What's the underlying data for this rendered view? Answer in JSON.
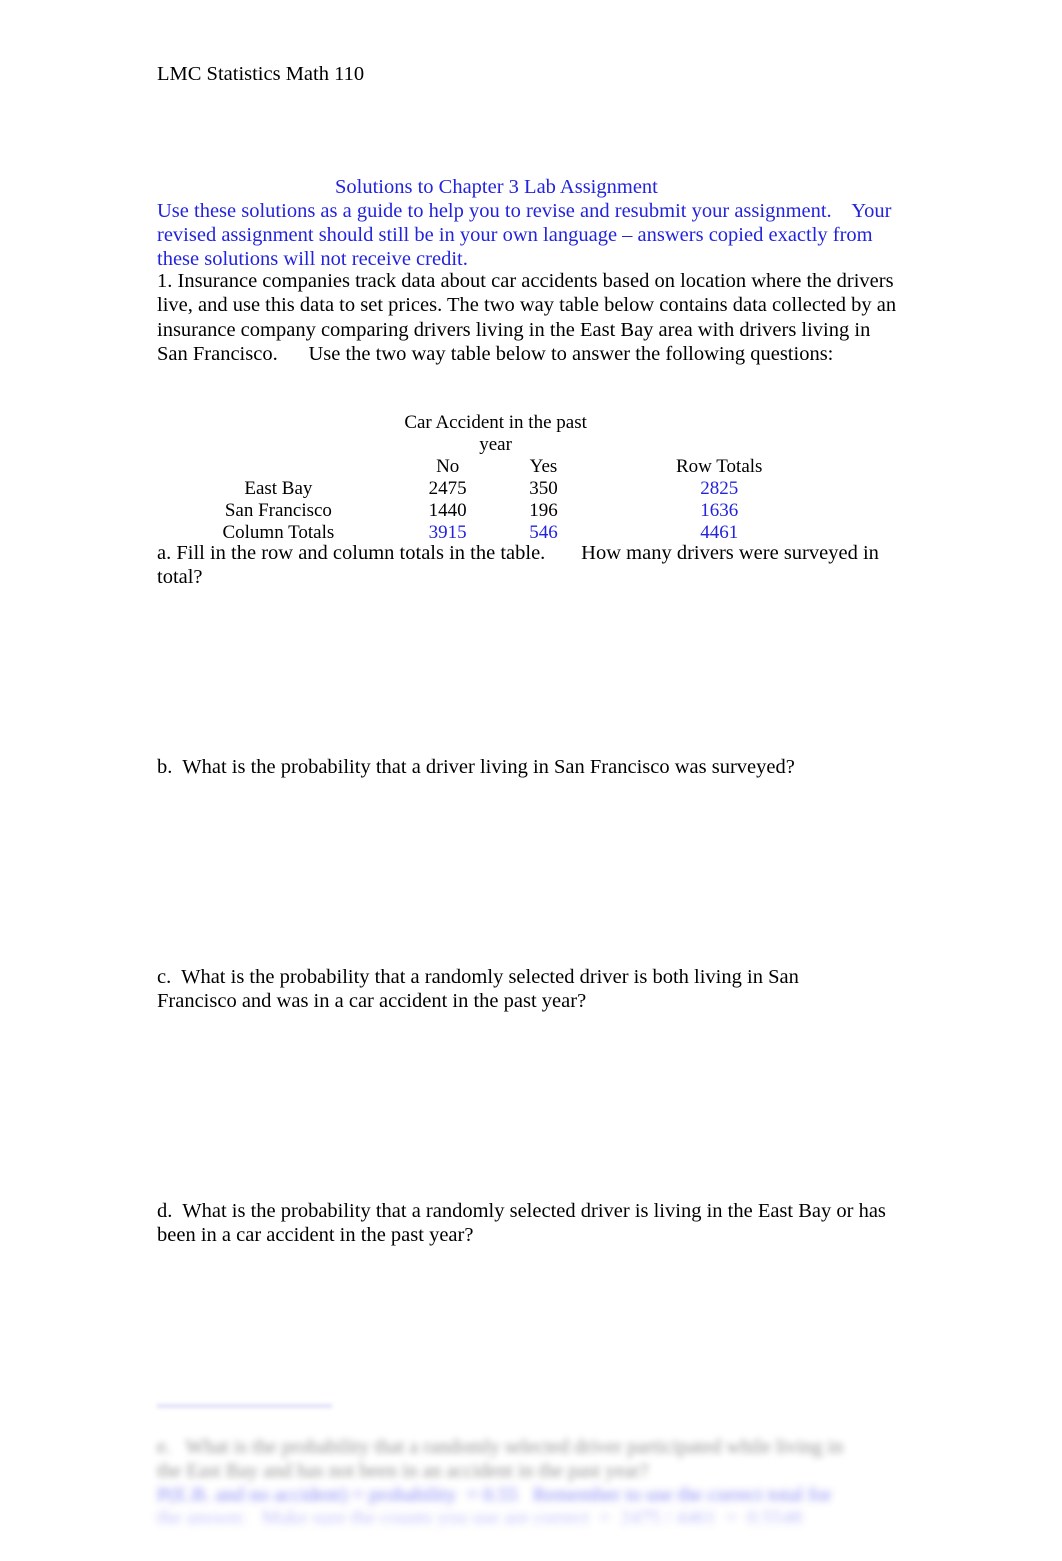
{
  "document": {
    "course_header": "LMC Statistics Math 110",
    "title_line": "Solutions to Chapter 3 Lab Assignment",
    "title_body": "Use these solutions as a guide to help you to revise and resubmit your assignment.    Your revised assignment should still be in your own language – answers copied exactly from these solutions will not receive credit.",
    "accent_blue": "#2323dd",
    "text_color": "#000000",
    "page_background": "#ffffff"
  },
  "question_1": {
    "intro": "1. Insurance companies track data about car accidents based on location where the drivers live, and use this data to set prices. The two way table below contains data collected by an insurance company comparing drivers living in the East Bay area with drivers living in San Francisco.      Use the two way table below to answer the following questions:",
    "table": {
      "span_header": "Car Accident in the past year",
      "column_headers": [
        "",
        "No",
        "Yes",
        "Row Totals"
      ],
      "rows": [
        {
          "label": "East Bay",
          "no": "2475",
          "yes": "350",
          "row_total": "2825",
          "no_is_answer": false,
          "yes_is_answer": false,
          "total_is_answer": true
        },
        {
          "label": "San Francisco",
          "no": "1440",
          "yes": "196",
          "row_total": "1636",
          "no_is_answer": false,
          "yes_is_answer": false,
          "total_is_answer": true
        },
        {
          "label": "Column Totals",
          "no": "3915",
          "yes": "546",
          "row_total": "4461",
          "no_is_answer": true,
          "yes_is_answer": true,
          "total_is_answer": true
        }
      ]
    },
    "parts": {
      "a": "a. Fill in the row and column totals in the table.       How many drivers were surveyed in total?",
      "b": "b.  What is the probability that a driver living in San Francisco was surveyed?",
      "c": "c.  What is the probability that a randomly selected driver is both living in San Francisco and was in a car accident in the past year?",
      "d": "d.  What is the probability that a randomly selected driver is living in the East Bay or has been in a car accident in the past year?"
    }
  },
  "bottom_fragment": {
    "note": "blurred and cut off at page edge",
    "question_text": "e.   What is the probability that a randomly selected driver participated while living in the East Bay and has not been in an accident in the past year?",
    "answer_text": "P(E.B. and no accident) = probability  = 0.55   Remember to use the correct total for the answer.   Make sure the counts you use are correct  =  2475 / 4461  =  0.5548"
  }
}
